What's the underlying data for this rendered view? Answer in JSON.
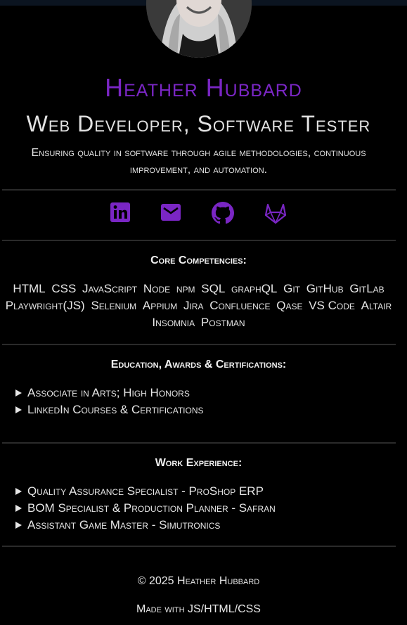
{
  "profile": {
    "name": "Heather Hubbard",
    "role": "Web Developer, Software Tester",
    "tagline": "Ensuring quality in software through agile methodologies, continuous improvement, and automation."
  },
  "socials": [
    {
      "icon": "linkedin-icon"
    },
    {
      "icon": "mail-icon"
    },
    {
      "icon": "github-icon"
    },
    {
      "icon": "gitlab-icon"
    }
  ],
  "competencies": {
    "title": "Core Competencies:",
    "items": [
      "HTML",
      "CSS",
      "JavaScript",
      "Node",
      "npm",
      "SQL",
      "graphQL",
      "Git",
      "GitHub",
      "GitLab",
      "Playwright(JS)",
      "Selenium",
      "Appium",
      "Jira",
      "Confluence",
      "Qase",
      "VS Code",
      "Altair",
      "Insomnia",
      "Postman"
    ]
  },
  "education": {
    "title": "Education, Awards & Certifications:",
    "items": [
      "Associate in Arts; High Honors",
      "LinkedIn Courses & Certifications"
    ]
  },
  "experience": {
    "title": "Work Experience:",
    "items": [
      "Quality Assurance Specialist - ProShop ERP",
      "BOM Specialist & Production Planner - Safran",
      "Assistant Game Master - Simutronics"
    ]
  },
  "footer": {
    "copyright": "© 2025 Heather Hubbard",
    "made_with": "Made with JS/HTML/CSS"
  },
  "colors": {
    "accent": "#7a26c4",
    "background": "#000000",
    "text": "#e6e6e6"
  }
}
